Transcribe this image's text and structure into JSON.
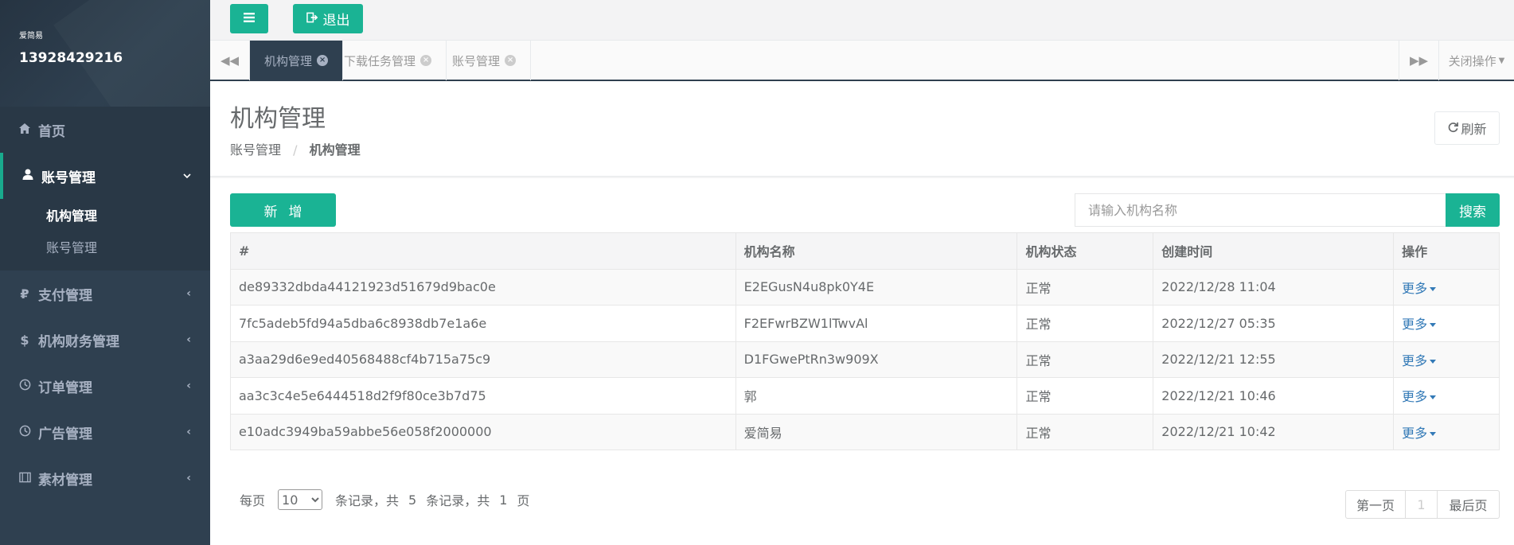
{
  "sidebar": {
    "profile_name": "爱简易",
    "profile_phone": "13928429216",
    "home": "首页",
    "account_mgmt": "账号管理",
    "sub_items": [
      "机构管理",
      "账号管理"
    ],
    "payment_mgmt": "支付管理",
    "org_finance_mgmt": "机构财务管理",
    "order_mgmt": "订单管理",
    "ad_mgmt": "广告管理",
    "material_mgmt": "素材管理"
  },
  "topbar": {
    "logout_label": "退出"
  },
  "tabs": {
    "items": [
      "机构管理",
      "下载任务管理",
      "账号管理"
    ],
    "close_ops": "关闭操作"
  },
  "heading": {
    "title": "机构管理",
    "breadcrumb_parent": "账号管理",
    "breadcrumb_current": "机构管理",
    "refresh_label": "刷新"
  },
  "toolbar": {
    "add_label": "新增",
    "search_placeholder": "请输入机构名称",
    "search_label": "搜索"
  },
  "table": {
    "headers": [
      "#",
      "机构名称",
      "机构状态",
      "创建时间",
      "操作"
    ],
    "rows": [
      {
        "id": "de89332dbda44121923d51679d9bac0e",
        "name": "E2EGusN4u8pk0Y4E",
        "status": "正常",
        "created": "2022/12/28 11:04",
        "action": "更多"
      },
      {
        "id": "7fc5adeb5fd94a5dba6c8938db7e1a6e",
        "name": "F2EFwrBZW1lTwvAl",
        "status": "正常",
        "created": "2022/12/27 05:35",
        "action": "更多"
      },
      {
        "id": "a3aa29d6e9ed40568488cf4b715a75c9",
        "name": "D1FGwePtRn3w909X",
        "status": "正常",
        "created": "2022/12/21 12:55",
        "action": "更多"
      },
      {
        "id": "aa3c3c4e5e6444518d2f9f80ce3b7d75",
        "name": "郭",
        "status": "正常",
        "created": "2022/12/21 10:46",
        "action": "更多"
      },
      {
        "id": "e10adc3949ba59abbe56e058f2000000",
        "name": "爱简易",
        "status": "正常",
        "created": "2022/12/21 10:42",
        "action": "更多"
      }
    ]
  },
  "pagination": {
    "per_page_prefix": "每页",
    "per_page_value": "10",
    "text_records_total": "条记录，共",
    "total_records": "5",
    "text_records_total2": "条记录，共",
    "total_pages": "1",
    "text_pages": "页",
    "first_label": "第一页",
    "current_page": "1",
    "last_label": "最后页"
  },
  "colors": {
    "sidebar_bg": "#2f4050",
    "accent": "#1ab394",
    "link": "#337ab7"
  }
}
